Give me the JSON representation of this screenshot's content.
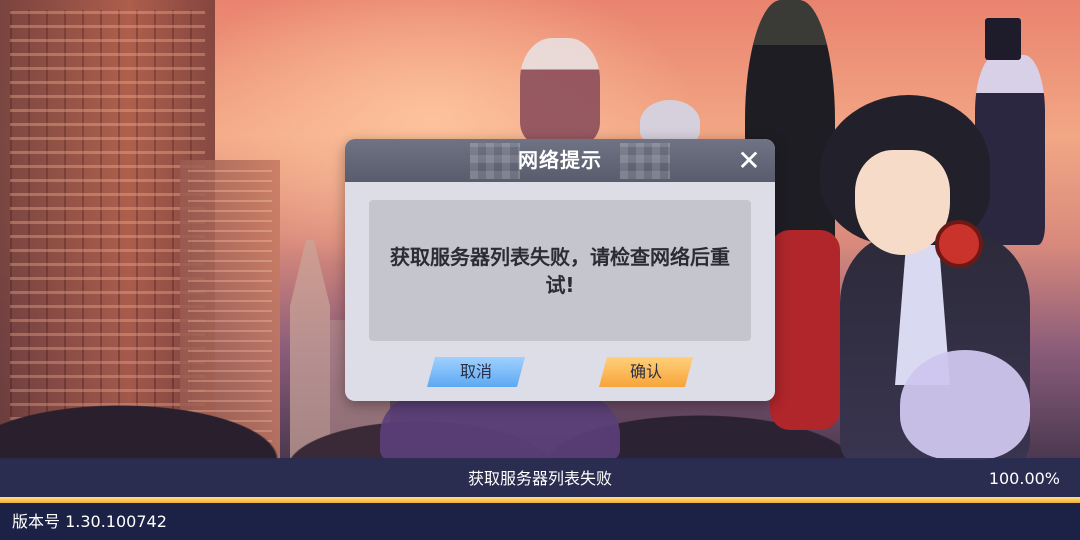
{
  "dialog": {
    "title": "网络提示",
    "close_icon": "close-icon",
    "message": "获取服务器列表失败，请检查网络后重试!",
    "cancel_label": "取消",
    "confirm_label": "确认"
  },
  "status": {
    "text": "获取服务器列表失败",
    "percent": "100.00%",
    "progress": 1.0
  },
  "footer": {
    "version": "版本号 1.30.100742"
  },
  "colors": {
    "cancel_button": "#5da9f2",
    "confirm_button": "#f7a43a",
    "status_bar": "#282c50",
    "progress_fill": "#f0b030"
  }
}
